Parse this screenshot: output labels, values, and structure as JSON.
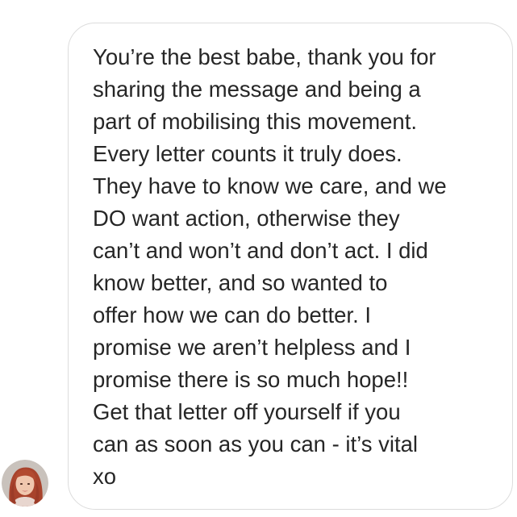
{
  "message": {
    "lines": [
      "You’re the best babe, thank you for",
      "sharing the message and being a",
      "part of mobilising this movement.",
      "Every letter counts it truly does.",
      "They have to know we care, and we",
      "DO want action, otherwise they",
      "can’t and won’t and don’t act. I did",
      "know better, and so wanted to",
      "offer how we can do better. I",
      "promise we aren’t helpless and I",
      "promise there is so much hope!!",
      "Get that letter off yourself if you",
      "can as soon as you can - it’s vital",
      "xo"
    ]
  },
  "colors": {
    "text": "#262626",
    "bubble_border": "#dcdcdc",
    "background": "#ffffff"
  },
  "avatar": {
    "icon": "user-avatar-photo"
  }
}
